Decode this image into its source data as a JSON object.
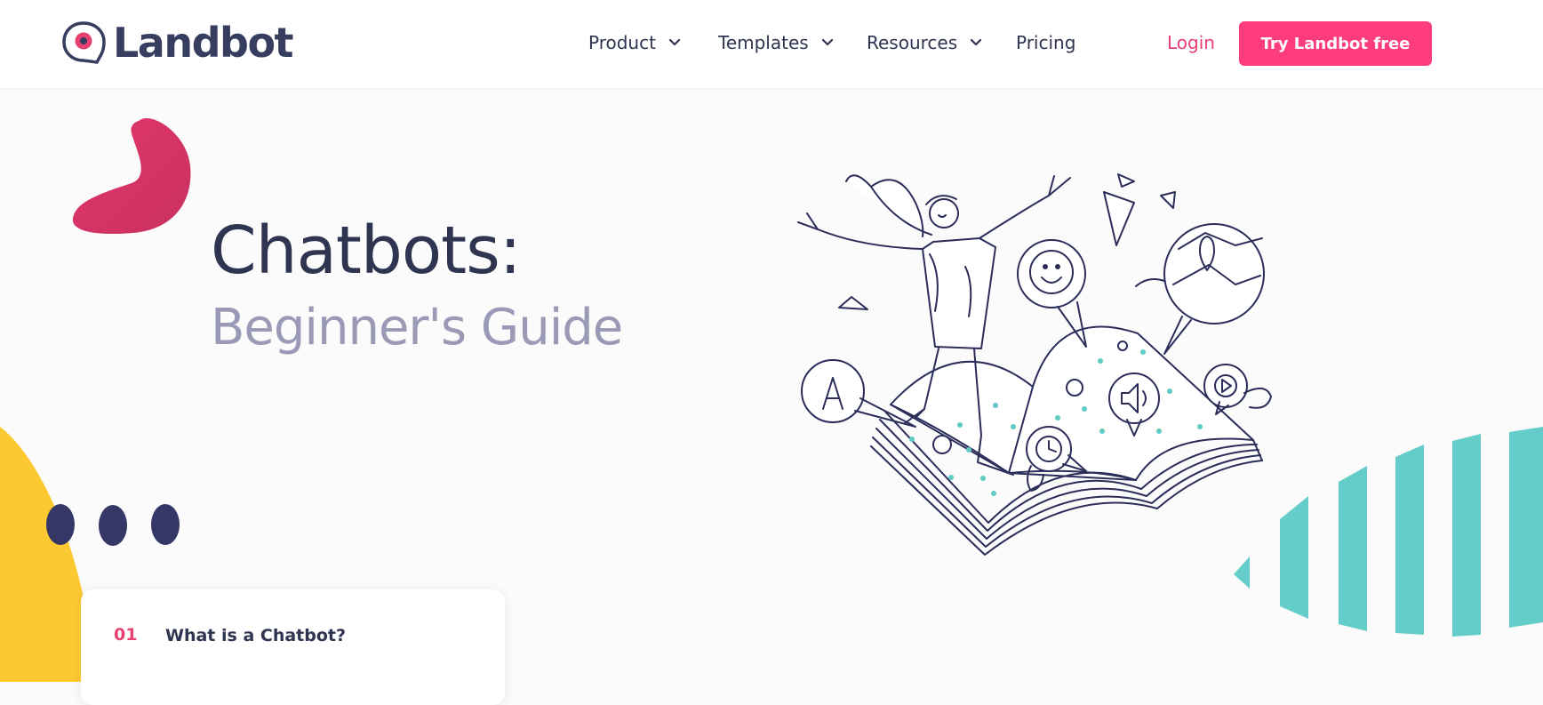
{
  "brand": {
    "name": "Landbot"
  },
  "nav": {
    "items": [
      {
        "label": "Product"
      },
      {
        "label": "Templates"
      },
      {
        "label": "Resources"
      },
      {
        "label": "Pricing"
      }
    ],
    "login_label": "Login",
    "cta_label": "Try Landbot free"
  },
  "hero": {
    "title": "Chatbots:",
    "subtitle": "Beginner's Guide"
  },
  "toc": {
    "items": [
      {
        "number": "01",
        "label": "What is a Chatbot?"
      }
    ]
  },
  "colors": {
    "brand_pink": "#fd3c7b",
    "navy": "#2f3550",
    "subtitle_gray": "#9a9ab6",
    "teal": "#64cdc9",
    "yellow": "#fdc933"
  }
}
